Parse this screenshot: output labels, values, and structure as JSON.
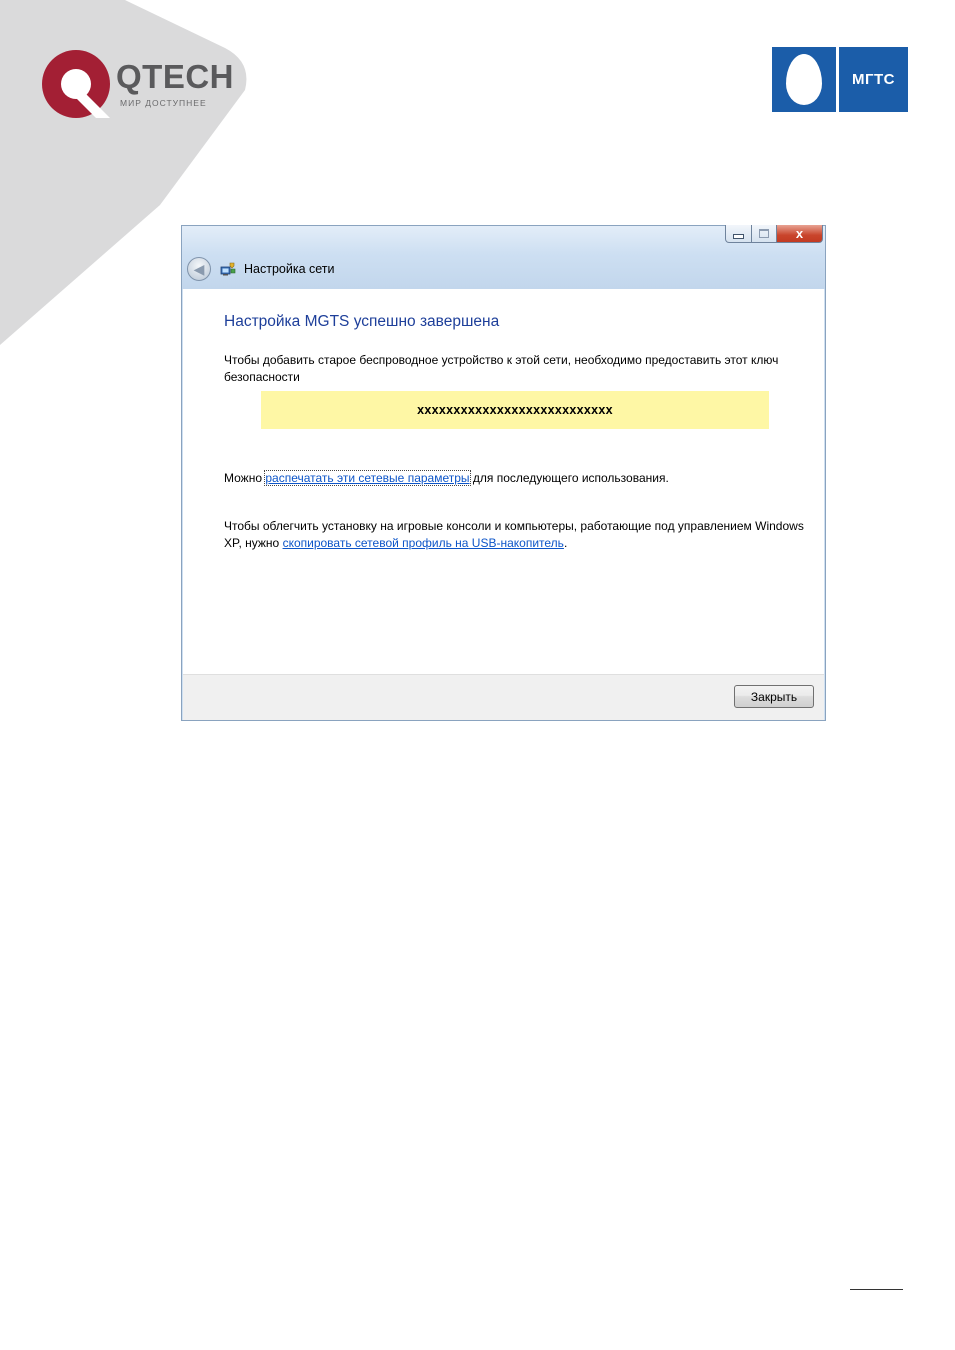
{
  "branding": {
    "qtech_name": "QTECH",
    "qtech_tagline": "МИР ДОСТУПНЕЕ",
    "mgts_name": "МГТС"
  },
  "window": {
    "title": "Настройка сети",
    "close_glyph": "x",
    "heading": "Настройка MGTS успешно завершена",
    "key_intro": "Чтобы добавить старое беспроводное устройство к этой сети, необходимо предоставить этот ключ безопасности",
    "security_key": "xxxxxxxxxxxxxxxxxxxxxxxxxxx",
    "print_prefix": "Можно ",
    "print_link": "распечатать эти сетевые параметры",
    "print_suffix": " для последующего использования.",
    "usb_prefix": "Чтобы облегчить установку на игровые консоли и компьютеры, работающие под управлением Windows XP, нужно ",
    "usb_link": "скопировать сетевой профиль на USB-накопитель",
    "usb_suffix": ".",
    "close_button": "Закрыть"
  },
  "colors": {
    "heading": "#1e3f9a",
    "link": "#0d55c8",
    "key_background": "#fef7a5",
    "qtech_red": "#a31f34",
    "mgts_blue": "#1b5da9"
  }
}
